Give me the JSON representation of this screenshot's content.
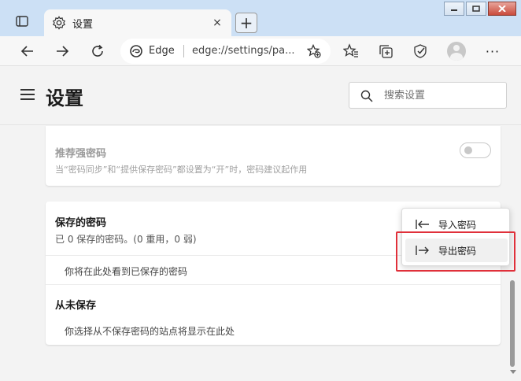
{
  "tab": {
    "title": "设置",
    "close": "×",
    "new_tab": "+"
  },
  "address": {
    "brand": "Edge",
    "url": "edge://settings/pa..."
  },
  "toolbar": {
    "more": "···"
  },
  "header": {
    "title": "设置",
    "search_placeholder": "搜索设置"
  },
  "strong_password": {
    "title": "推荐强密码",
    "desc": "当“密码同步”和“提供保存密码”都设置为“开”时，密码建议起作用",
    "enabled": false
  },
  "saved_passwords": {
    "title": "保存的密码",
    "summary": "已 0 保存的密码。(0 重用，0 弱)",
    "empty_text": "你将在此处看到已保存的密码",
    "never_saved_title": "从未保存",
    "never_saved_text": "你选择从不保存密码的站点将显示在此处"
  },
  "menu": {
    "import": "导入密码",
    "export": "导出密码"
  },
  "colors": {
    "highlight": "#e0303a",
    "tabbar": "#cce0f5"
  }
}
